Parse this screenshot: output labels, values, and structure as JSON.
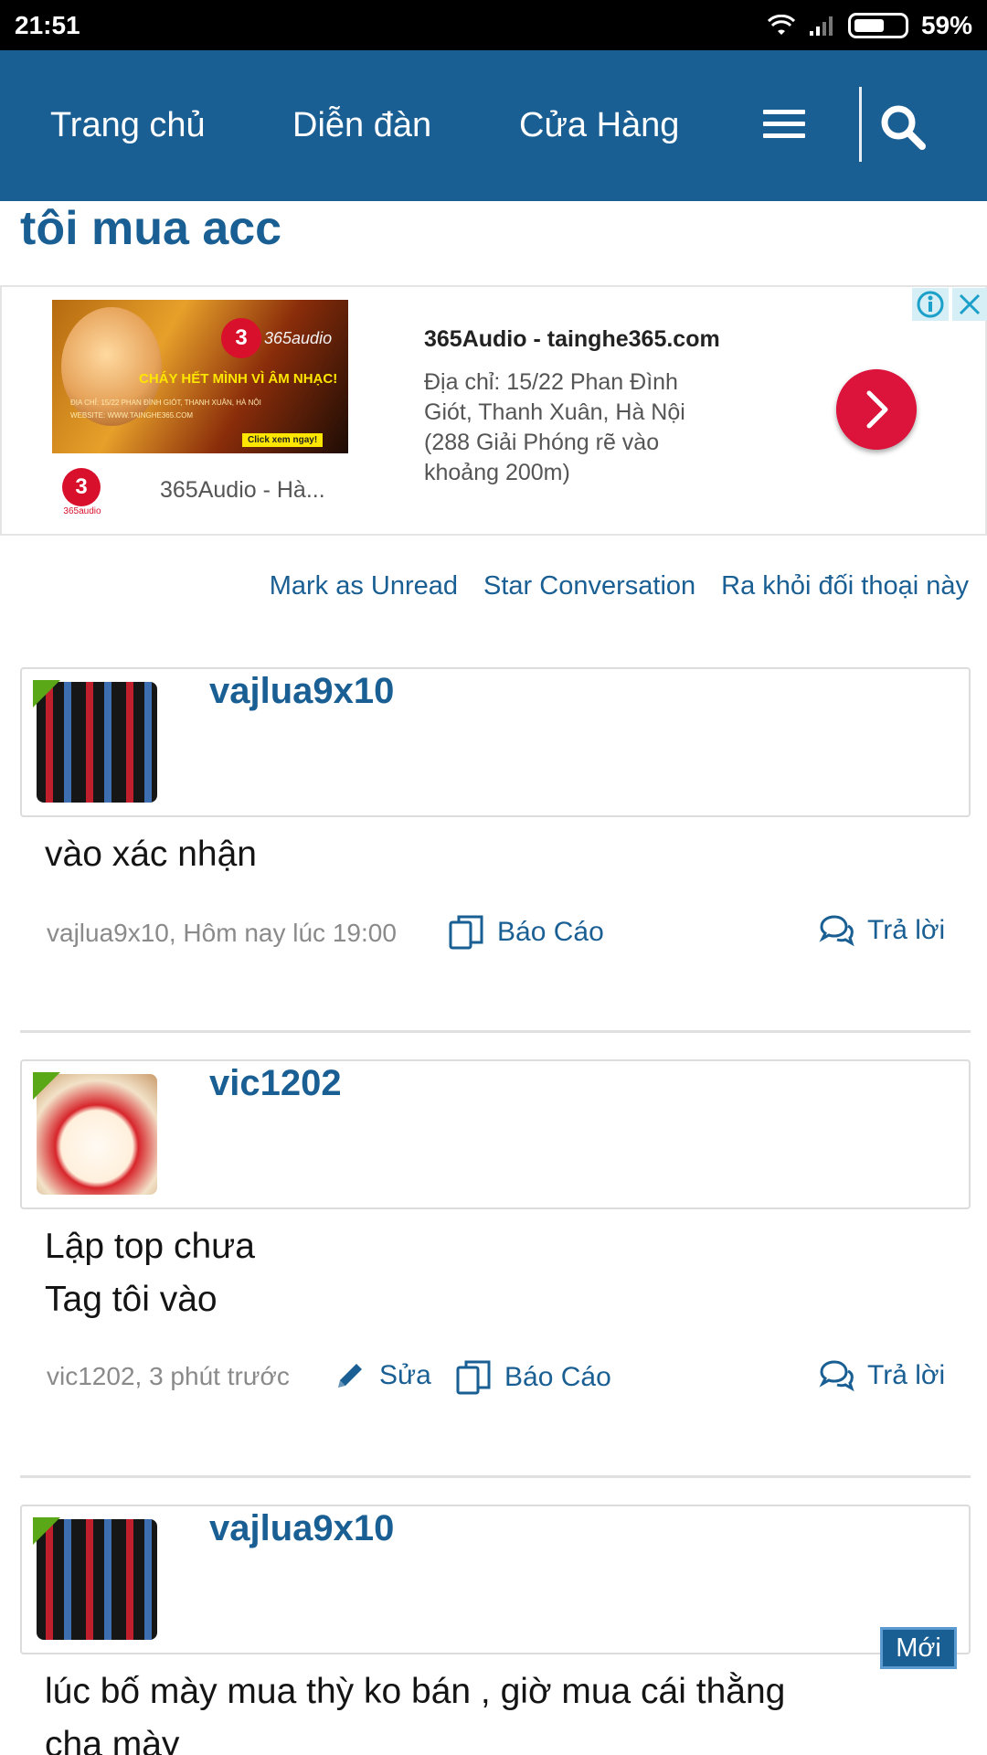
{
  "status_bar": {
    "time": "21:51",
    "battery_level": 0.59,
    "battery_text": "59%",
    "icons": [
      "wifi-icon",
      "signal-icon",
      "battery-icon"
    ]
  },
  "nav": {
    "items": [
      "Trang chủ",
      "Diễn đàn",
      "Cửa Hàng"
    ],
    "menu_icon": "hamburger-menu-icon",
    "search_icon": "search-icon",
    "bg_color": "#1a5f93"
  },
  "page": {
    "title": "tôi mua acc"
  },
  "ad": {
    "image_text": {
      "brand_mark": "3",
      "brand_word": "365audio",
      "slogan": "CHÁY HẾT MÌNH VÌ ÂM NHẠC!",
      "fine_line_1": "ĐỊA CHỈ: 15/22 PHAN ĐÌNH GIÓT, THANH XUÂN, HÀ NỘI",
      "fine_line_2": "WEBSITE: WWW.TAINGHE365.COM",
      "cta": "Click xem ngay!"
    },
    "logo_mark": "3",
    "logo_text": "365audio",
    "sponsor": "365Audio - Hà...",
    "headline": "365Audio - tainghe365.com",
    "body": "Địa chỉ: 15/22 Phan Đình Giót, Thanh Xuân, Hà Nội (288 Giải Phóng rẽ vào khoảng 200m)",
    "arrow_icon": "chevron-right-icon",
    "info_icon": "info-icon",
    "close_icon": "close-icon",
    "accent": "#dc143c"
  },
  "conversation_actions": [
    "Mark as Unread",
    "Star Conversation",
    "Ra khỏi đối thoại này"
  ],
  "messages": [
    {
      "user": "vajlua9x10",
      "lines": [
        "vào xác nhận"
      ],
      "meta": "vajlua9x10, Hôm nay lúc 19:00",
      "report": "Báo Cáo",
      "reply": "Trả lời"
    },
    {
      "user": "vic1202",
      "lines": [
        "Lập top chưa",
        "Tag tôi vào"
      ],
      "meta": "vic1202, 3 phút trước",
      "edit": "Sửa",
      "report": "Báo Cáo",
      "reply": "Trả lời"
    },
    {
      "user": "vajlua9x10",
      "lines": [
        "lúc bố mày mua thỳ ko bán , giờ mua cái thằng",
        "cha mày"
      ]
    }
  ],
  "new_badge": "Mới"
}
